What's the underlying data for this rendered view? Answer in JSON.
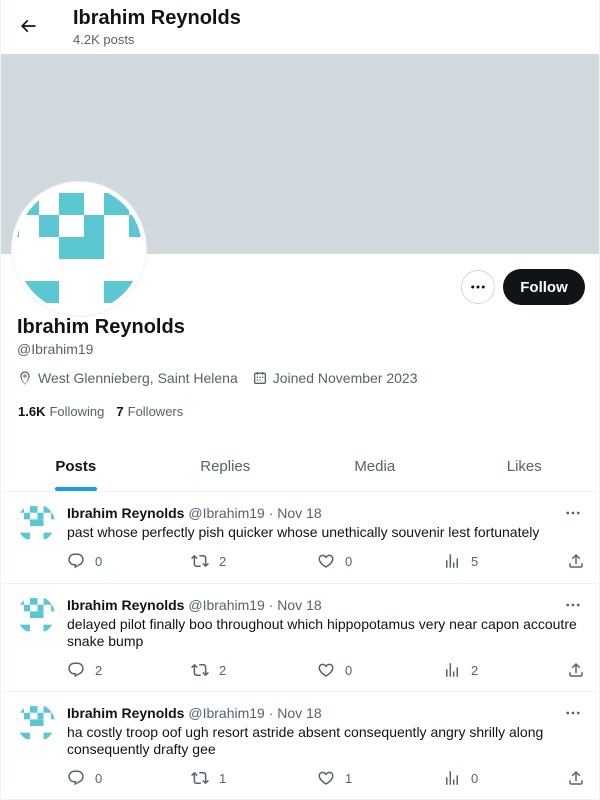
{
  "header": {
    "title": "Ibrahim Reynolds",
    "post_count": "4.2K posts"
  },
  "profile": {
    "name": "Ibrahim Reynolds",
    "handle": "@Ibrahim19",
    "location": "West Glennieberg, Saint Helena",
    "joined": "Joined November 2023",
    "following_count": "1.6K",
    "following_label": "Following",
    "followers_count": "7",
    "followers_label": "Followers",
    "follow_label": "Follow"
  },
  "colors": {
    "banner": "#cfd9de",
    "avatar_pattern": "#5bc7d2",
    "accent": "#1d9bf0"
  },
  "icons": {
    "back": "arrow-left-icon",
    "more": "more-horizontal-icon",
    "location": "location-pin-icon",
    "calendar": "calendar-icon",
    "reply": "reply-icon",
    "repost": "repost-icon",
    "like": "heart-icon",
    "views": "views-icon",
    "share": "share-icon"
  },
  "tabs": [
    {
      "label": "Posts",
      "active": true
    },
    {
      "label": "Replies",
      "active": false
    },
    {
      "label": "Media",
      "active": false
    },
    {
      "label": "Likes",
      "active": false
    }
  ],
  "posts": [
    {
      "author": "Ibrahim Reynolds",
      "handle": "@Ibrahim19",
      "separator": "·",
      "date": "Nov 18",
      "text": "past whose perfectly pish quicker whose unethically souvenir lest fortunately",
      "replies": "0",
      "reposts": "2",
      "likes": "0",
      "views": "5"
    },
    {
      "author": "Ibrahim Reynolds",
      "handle": "@Ibrahim19",
      "separator": "·",
      "date": "Nov 18",
      "text": "delayed pilot finally boo throughout which hippopotamus very near capon accoutre snake bump",
      "replies": "2",
      "reposts": "2",
      "likes": "0",
      "views": "2"
    },
    {
      "author": "Ibrahim Reynolds",
      "handle": "@Ibrahim19",
      "separator": "·",
      "date": "Nov 18",
      "text": "ha costly troop oof ugh resort astride absent consequently angry shrilly along consequently drafty gee",
      "replies": "0",
      "reposts": "1",
      "likes": "1",
      "views": "0"
    }
  ]
}
